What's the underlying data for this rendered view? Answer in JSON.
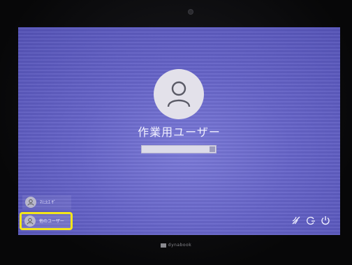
{
  "lock_screen": {
    "username": "作業用ユーザー",
    "password_placeholder": ""
  },
  "user_list": {
    "items": [
      {
        "label": "ﾏﾐﾆﾋｴ ｻﾞ",
        "selected": false
      },
      {
        "label": "他のユーザー",
        "selected": true
      }
    ]
  },
  "device": {
    "brand": "dynabook"
  },
  "icons": {
    "network": "wifi-icon",
    "accessibility": "ease-of-access-icon",
    "power": "power-icon"
  },
  "colors": {
    "background": "#6664c8",
    "selection_highlight": "#f3e51a"
  }
}
